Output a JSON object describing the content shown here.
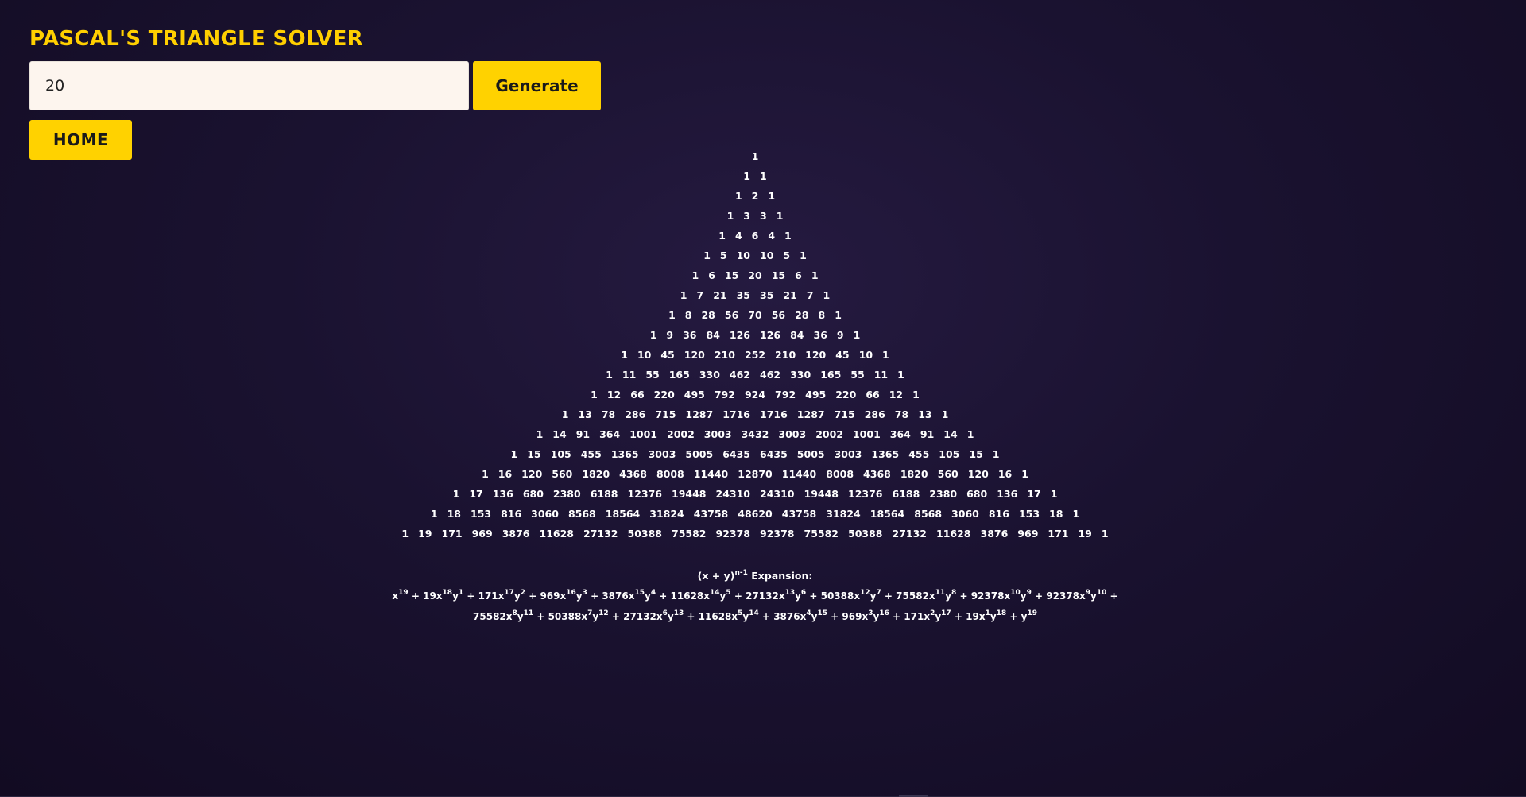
{
  "header": {
    "title": "PASCAL'S TRIANGLE SOLVER"
  },
  "form": {
    "rows_value": "20",
    "generate_label": "Generate",
    "home_label": "HOME"
  },
  "triangle": [
    [
      1
    ],
    [
      1,
      1
    ],
    [
      1,
      2,
      1
    ],
    [
      1,
      3,
      3,
      1
    ],
    [
      1,
      4,
      6,
      4,
      1
    ],
    [
      1,
      5,
      10,
      10,
      5,
      1
    ],
    [
      1,
      6,
      15,
      20,
      15,
      6,
      1
    ],
    [
      1,
      7,
      21,
      35,
      35,
      21,
      7,
      1
    ],
    [
      1,
      8,
      28,
      56,
      70,
      56,
      28,
      8,
      1
    ],
    [
      1,
      9,
      36,
      84,
      126,
      126,
      84,
      36,
      9,
      1
    ],
    [
      1,
      10,
      45,
      120,
      210,
      252,
      210,
      120,
      45,
      10,
      1
    ],
    [
      1,
      11,
      55,
      165,
      330,
      462,
      462,
      330,
      165,
      55,
      11,
      1
    ],
    [
      1,
      12,
      66,
      220,
      495,
      792,
      924,
      792,
      495,
      220,
      66,
      12,
      1
    ],
    [
      1,
      13,
      78,
      286,
      715,
      1287,
      1716,
      1716,
      1287,
      715,
      286,
      78,
      13,
      1
    ],
    [
      1,
      14,
      91,
      364,
      1001,
      2002,
      3003,
      3432,
      3003,
      2002,
      1001,
      364,
      91,
      14,
      1
    ],
    [
      1,
      15,
      105,
      455,
      1365,
      3003,
      5005,
      6435,
      6435,
      5005,
      3003,
      1365,
      455,
      105,
      15,
      1
    ],
    [
      1,
      16,
      120,
      560,
      1820,
      4368,
      8008,
      11440,
      12870,
      11440,
      8008,
      4368,
      1820,
      560,
      120,
      16,
      1
    ],
    [
      1,
      17,
      136,
      680,
      2380,
      6188,
      12376,
      19448,
      24310,
      24310,
      19448,
      12376,
      6188,
      2380,
      680,
      136,
      17,
      1
    ],
    [
      1,
      18,
      153,
      816,
      3060,
      8568,
      18564,
      31824,
      43758,
      48620,
      43758,
      31824,
      18564,
      8568,
      3060,
      816,
      153,
      18,
      1
    ],
    [
      1,
      19,
      171,
      969,
      3876,
      11628,
      27132,
      50388,
      75582,
      92378,
      92378,
      75582,
      50388,
      27132,
      11628,
      3876,
      969,
      171,
      19,
      1
    ]
  ],
  "expansion": {
    "title_base": "(x + y)",
    "title_exp": "n-1",
    "title_suffix": " Expansion:",
    "terms": [
      {
        "coef": "",
        "x": "19",
        "y": null
      },
      {
        "coef": "19",
        "x": "18",
        "y": "1"
      },
      {
        "coef": "171",
        "x": "17",
        "y": "2"
      },
      {
        "coef": "969",
        "x": "16",
        "y": "3"
      },
      {
        "coef": "3876",
        "x": "15",
        "y": "4"
      },
      {
        "coef": "11628",
        "x": "14",
        "y": "5"
      },
      {
        "coef": "27132",
        "x": "13",
        "y": "6"
      },
      {
        "coef": "50388",
        "x": "12",
        "y": "7"
      },
      {
        "coef": "75582",
        "x": "11",
        "y": "8"
      },
      {
        "coef": "92378",
        "x": "10",
        "y": "9"
      },
      {
        "coef": "92378",
        "x": "9",
        "y": "10"
      },
      {
        "coef": "75582",
        "x": "8",
        "y": "11"
      },
      {
        "coef": "50388",
        "x": "7",
        "y": "12"
      },
      {
        "coef": "27132",
        "x": "6",
        "y": "13"
      },
      {
        "coef": "11628",
        "x": "5",
        "y": "14"
      },
      {
        "coef": "3876",
        "x": "4",
        "y": "15"
      },
      {
        "coef": "969",
        "x": "3",
        "y": "16"
      },
      {
        "coef": "171",
        "x": "2",
        "y": "17"
      },
      {
        "coef": "19",
        "x": "1",
        "y": "18"
      },
      {
        "coef": "",
        "x": null,
        "y": "19"
      }
    ]
  }
}
